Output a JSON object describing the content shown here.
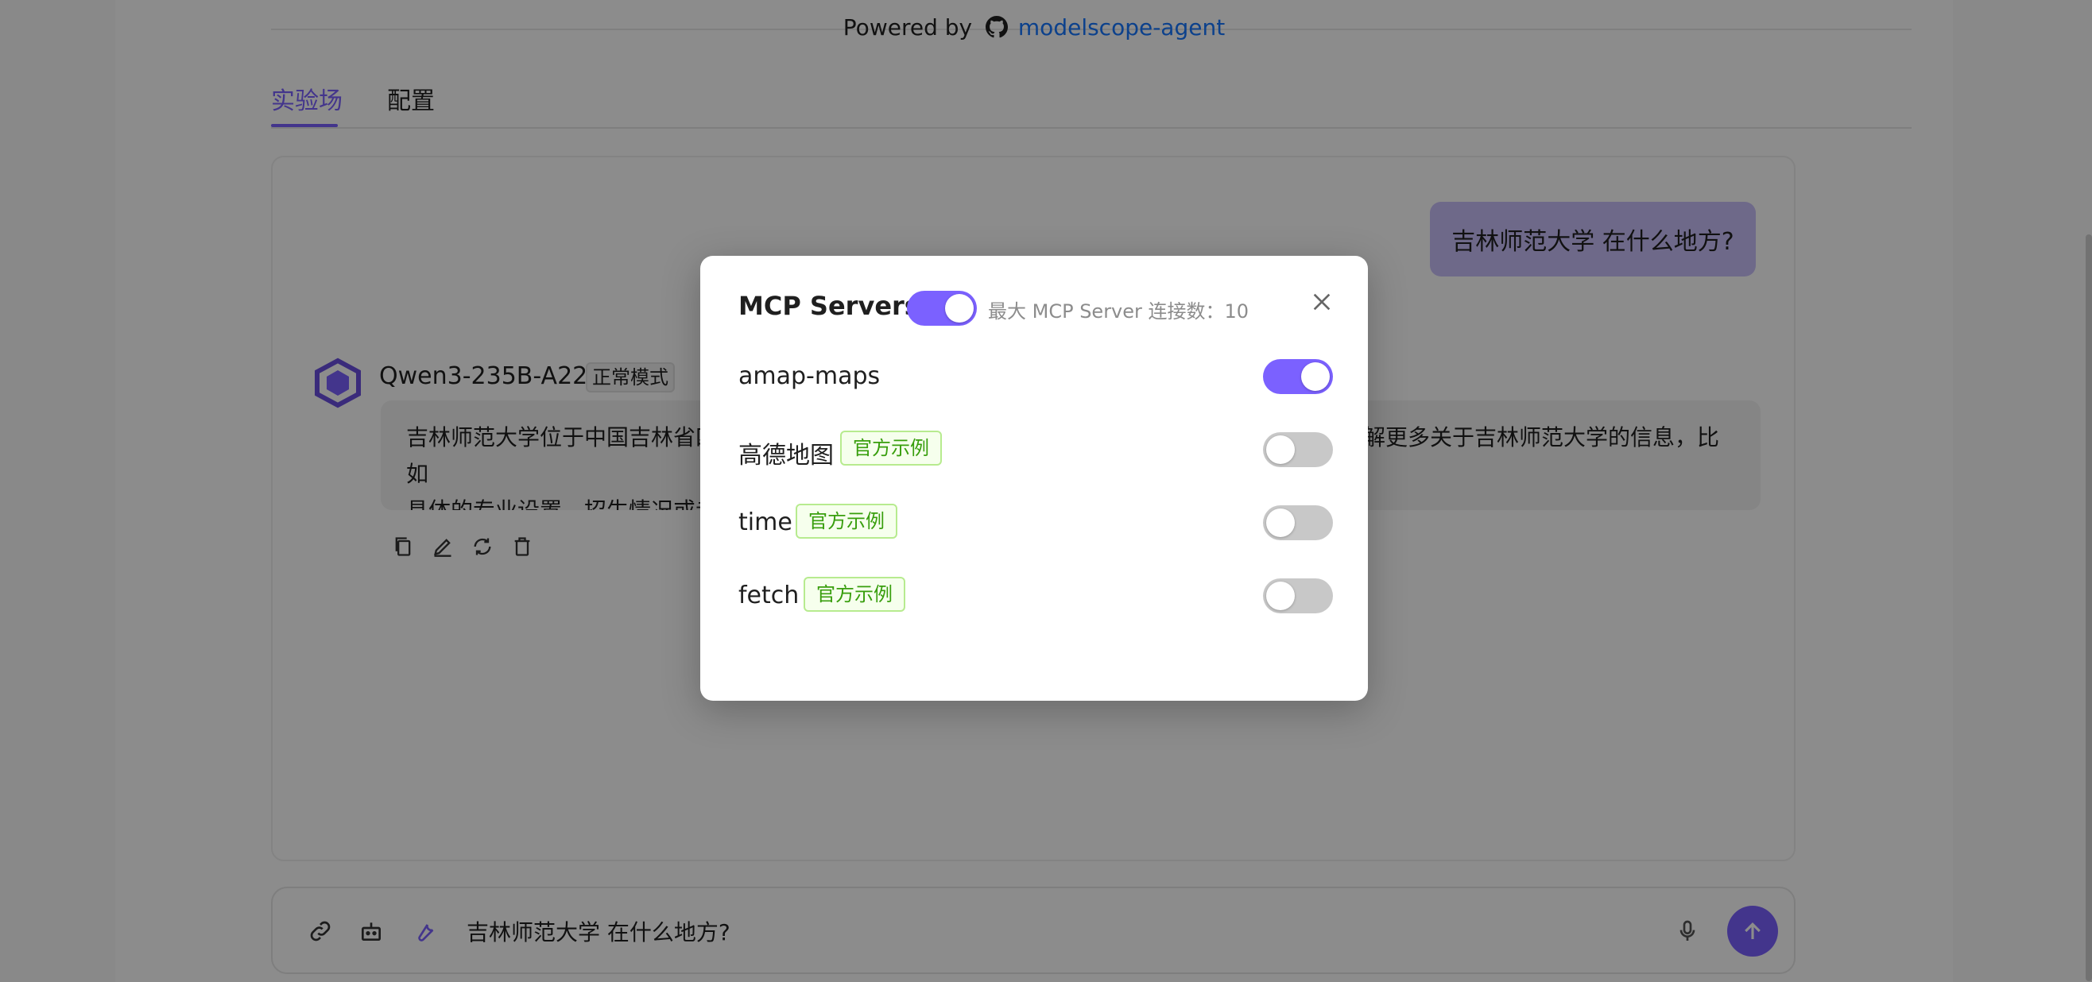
{
  "header": {
    "powered_prefix": "Powered by",
    "powered_link": "modelscope-agent"
  },
  "tabs": [
    {
      "label": "实验场",
      "active": true
    },
    {
      "label": "配置",
      "active": false
    }
  ],
  "chat": {
    "user_message": "吉林师范大学 在什么地方?",
    "model_name": "Qwen3-235B-A22B",
    "mode_tag": "正常模式",
    "bot_message_line1": "吉林师范大学位于中国吉林省四平市。该校是一所以师范教育为特色的综合性大学。如果您需要了解更多关于吉林师范大学的信息，比如",
    "bot_message_line2": "具体的专业设置、招生情况或者校园生活等，请随时告诉我！"
  },
  "input": {
    "value": "吉林师范大学 在什么地方?"
  },
  "modal": {
    "title": "MCP Servers",
    "master_enabled": true,
    "max_connections": "最大 MCP Server 连接数：10",
    "servers": [
      {
        "name": "amap-maps",
        "tag": "",
        "enabled": true
      },
      {
        "name": "高德地图",
        "tag": "官方示例",
        "enabled": false
      },
      {
        "name": "time",
        "tag": "官方示例",
        "enabled": false
      },
      {
        "name": "fetch",
        "tag": "官方示例",
        "enabled": false
      }
    ]
  },
  "colors": {
    "accent": "#7b61ff",
    "link": "#1677ff",
    "tag_green": "#389e0d"
  }
}
